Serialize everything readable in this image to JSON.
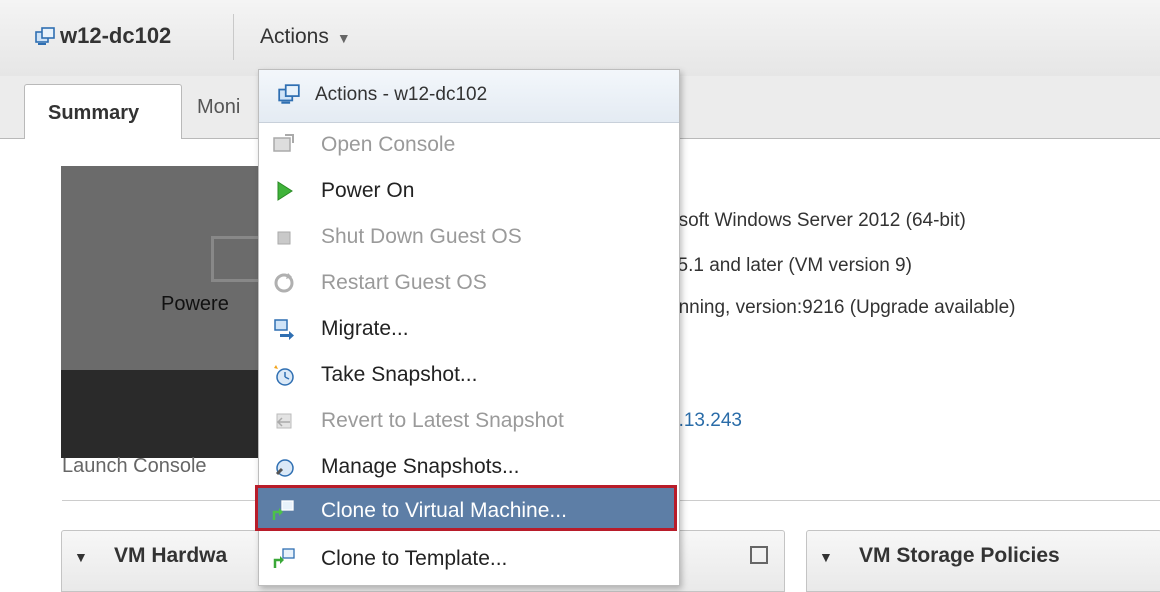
{
  "header": {
    "vm_name": "w12-dc102",
    "actions_label": "Actions"
  },
  "tabs": [
    {
      "label": "Summary"
    },
    {
      "label": "Moni"
    }
  ],
  "summary": {
    "console_status": "Powere",
    "launch_console": "Launch Console",
    "info_lines": [
      "osoft Windows Server 2012 (64-bit)",
      "i 5.1 and later (VM version 9)",
      "unning, version:9216 (Upgrade available)"
    ],
    "ip_fragment": "2.13.243"
  },
  "panels": {
    "hardware": {
      "label": "VM Hardwa"
    },
    "storage": {
      "label": "VM Storage Policies"
    }
  },
  "menu": {
    "title": "Actions - w12-dc102",
    "items": [
      {
        "label": "Open Console",
        "icon": "console-icon",
        "enabled": false
      },
      {
        "label": "Power On",
        "icon": "play-icon",
        "enabled": true
      },
      {
        "label": "Shut Down Guest OS",
        "icon": "stop-icon",
        "enabled": false
      },
      {
        "label": "Restart Guest OS",
        "icon": "restart-icon",
        "enabled": false
      },
      {
        "label": "Migrate...",
        "icon": "migrate-icon",
        "enabled": true
      },
      {
        "label": "Take Snapshot...",
        "icon": "snapshot-icon",
        "enabled": true
      },
      {
        "label": "Revert to Latest Snapshot",
        "icon": "revert-icon",
        "enabled": false
      },
      {
        "label": "Manage Snapshots...",
        "icon": "manage-snapshots-icon",
        "enabled": true
      },
      {
        "label": "Clone to Virtual Machine...",
        "icon": "clone-vm-icon",
        "enabled": true,
        "selected": true
      },
      {
        "label": "Clone to Template...",
        "icon": "clone-template-icon",
        "enabled": true
      }
    ]
  },
  "colors": {
    "selection": "#5d7ea6",
    "highlight_border": "#b81c2a",
    "link": "#2a6ca8"
  }
}
